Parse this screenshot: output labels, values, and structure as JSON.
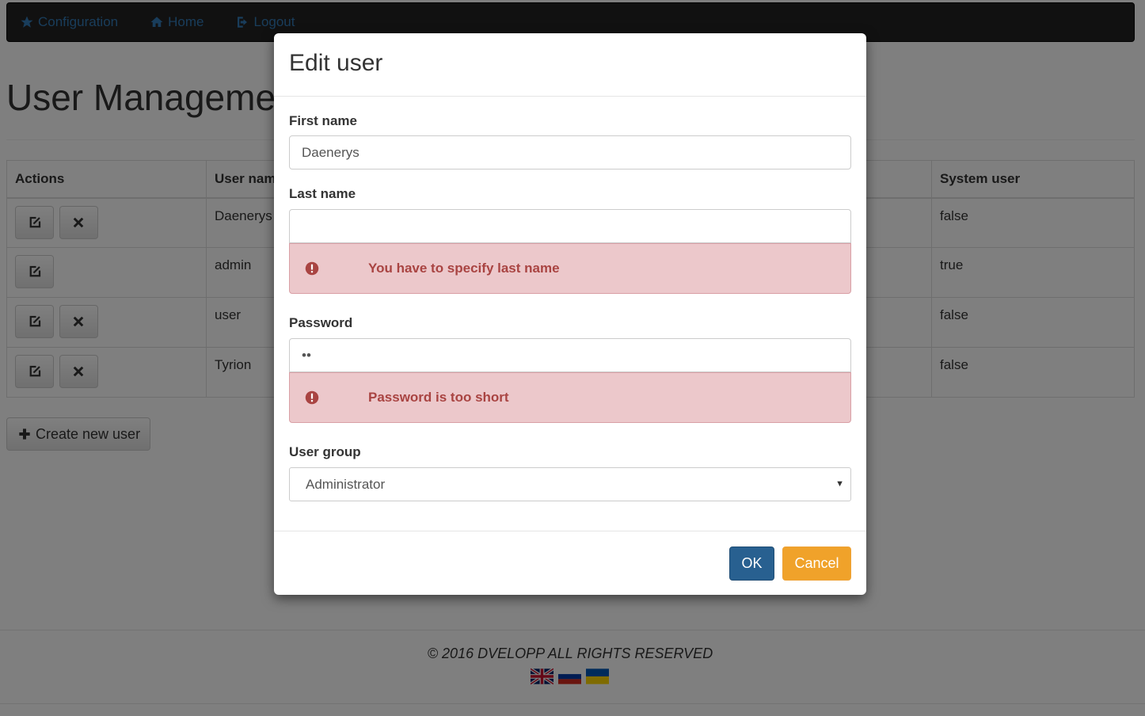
{
  "nav": {
    "items": [
      {
        "label": "Configuration",
        "icon": "star-icon"
      },
      {
        "label": "Home",
        "icon": "home-icon"
      },
      {
        "label": "Logout",
        "icon": "logout-icon"
      }
    ]
  },
  "page": {
    "title": "User Management"
  },
  "table": {
    "headers": [
      "Actions",
      "User name",
      "",
      "System user"
    ],
    "rows": [
      {
        "username": "Daenerys",
        "system_user": "false",
        "can_delete": true
      },
      {
        "username": "admin",
        "system_user": "true",
        "can_delete": false
      },
      {
        "username": "user",
        "system_user": "false",
        "can_delete": true
      },
      {
        "username": "Tyrion",
        "system_user": "false",
        "can_delete": true
      }
    ]
  },
  "create_button": {
    "label": "Create new user",
    "icon": "plus-icon"
  },
  "footer": {
    "copyright": "© 2016 DVELOPP ALL RIGHTS RESERVED",
    "flags": [
      "uk-flag-icon",
      "russia-flag-icon",
      "ukraine-flag-icon"
    ]
  },
  "modal": {
    "title": "Edit user",
    "first_name": {
      "label": "First name",
      "value": "Daenerys"
    },
    "last_name": {
      "label": "Last name",
      "value": "",
      "error": "You have to specify last name"
    },
    "password": {
      "label": "Password",
      "value": "••",
      "error": "Password is too short"
    },
    "user_group": {
      "label": "User group",
      "selected": "Administrator"
    },
    "ok_label": "OK",
    "cancel_label": "Cancel"
  },
  "colors": {
    "navbar_bg": "#222222",
    "link": "#337ab7",
    "primary_button": "#286090",
    "warning_button": "#f0a22a",
    "error_text": "#a94442",
    "error_bg": "#ecc8cb"
  }
}
